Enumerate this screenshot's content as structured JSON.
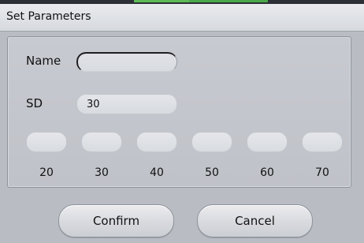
{
  "dialog": {
    "title": "Set Parameters"
  },
  "form": {
    "name_label": "Name",
    "name_value": "",
    "sd_label": "SD",
    "sd_value": "30"
  },
  "slots": [
    "20",
    "30",
    "40",
    "50",
    "60",
    "70"
  ],
  "buttons": {
    "confirm": "Confirm",
    "cancel": "Cancel"
  }
}
